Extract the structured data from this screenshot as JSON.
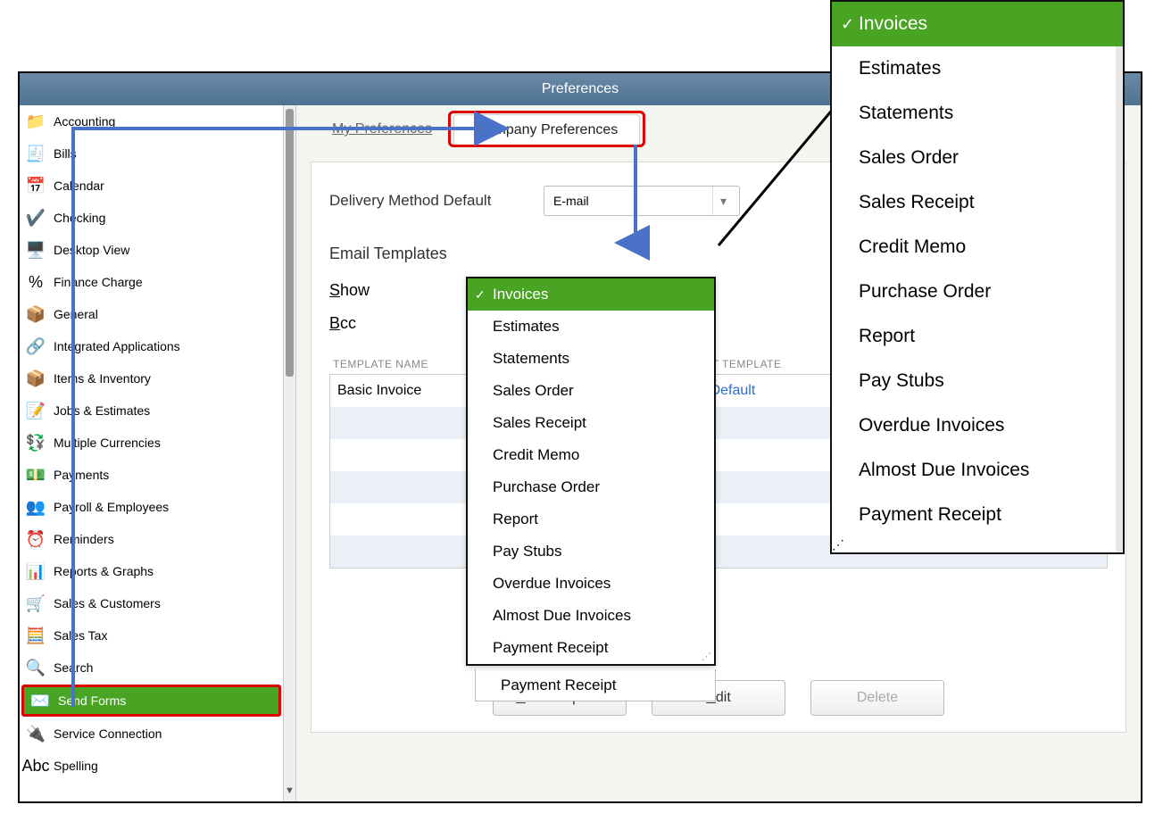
{
  "window": {
    "title": "Preferences"
  },
  "sidebar": {
    "items": [
      {
        "label": "Accounting",
        "icon": "📁",
        "iconName": "accounting-icon"
      },
      {
        "label": "Bills",
        "icon": "🧾",
        "iconName": "bills-icon"
      },
      {
        "label": "Calendar",
        "icon": "📅",
        "iconName": "calendar-icon"
      },
      {
        "label": "Checking",
        "icon": "✔️",
        "iconName": "checking-icon"
      },
      {
        "label": "Desktop View",
        "icon": "🖥️",
        "iconName": "desktop-view-icon"
      },
      {
        "label": "Finance Charge",
        "icon": "%",
        "iconName": "finance-charge-icon"
      },
      {
        "label": "General",
        "icon": "📦",
        "iconName": "general-icon"
      },
      {
        "label": "Integrated Applications",
        "icon": "🔗",
        "iconName": "integrated-apps-icon"
      },
      {
        "label": "Items & Inventory",
        "icon": "📦",
        "iconName": "items-inventory-icon"
      },
      {
        "label": "Jobs & Estimates",
        "icon": "📝",
        "iconName": "jobs-estimates-icon"
      },
      {
        "label": "Multiple Currencies",
        "icon": "💱",
        "iconName": "multiple-currencies-icon"
      },
      {
        "label": "Payments",
        "icon": "💵",
        "iconName": "payments-icon"
      },
      {
        "label": "Payroll & Employees",
        "icon": "👥",
        "iconName": "payroll-employees-icon"
      },
      {
        "label": "Reminders",
        "icon": "⏰",
        "iconName": "reminders-icon"
      },
      {
        "label": "Reports & Graphs",
        "icon": "📊",
        "iconName": "reports-graphs-icon"
      },
      {
        "label": "Sales & Customers",
        "icon": "🛒",
        "iconName": "sales-customers-icon"
      },
      {
        "label": "Sales Tax",
        "icon": "🧮",
        "iconName": "sales-tax-icon"
      },
      {
        "label": "Search",
        "icon": "🔍",
        "iconName": "search-icon"
      },
      {
        "label": "Send Forms",
        "icon": "✉️",
        "iconName": "send-forms-icon",
        "active": true
      },
      {
        "label": "Service Connection",
        "icon": "🔌",
        "iconName": "service-connection-icon"
      },
      {
        "label": "Spelling",
        "icon": "Abc",
        "iconName": "spelling-icon"
      }
    ]
  },
  "tabs": {
    "my": "My Preferences",
    "company": "Company Preferences"
  },
  "fields": {
    "deliveryLabel": "Delivery Method Default",
    "deliveryValue": "E-mail",
    "emailTemplatesLabel": "Email Templates",
    "showLabel": "Show",
    "bccLabel": "Bcc"
  },
  "template_dropdown": {
    "options": [
      "Invoices",
      "Estimates",
      "Statements",
      "Sales Order",
      "Sales Receipt",
      "Credit Memo",
      "Purchase Order",
      "Report",
      "Pay Stubs",
      "Overdue Invoices",
      "Almost Due Invoices",
      "Payment Receipt"
    ],
    "selected": "Invoices"
  },
  "table": {
    "headers": {
      "name": "TEMPLATE NAME",
      "default": "LT TEMPLATE"
    },
    "rows": [
      {
        "name": "Basic Invoice",
        "default": "Default"
      }
    ]
  },
  "buttons": {
    "add": "Add Template",
    "edit": "Edit",
    "delete": "Delete"
  },
  "colors": {
    "accent_green": "#4aa423",
    "highlight_red": "#d00000",
    "arrow_blue": "#4a72c8"
  }
}
